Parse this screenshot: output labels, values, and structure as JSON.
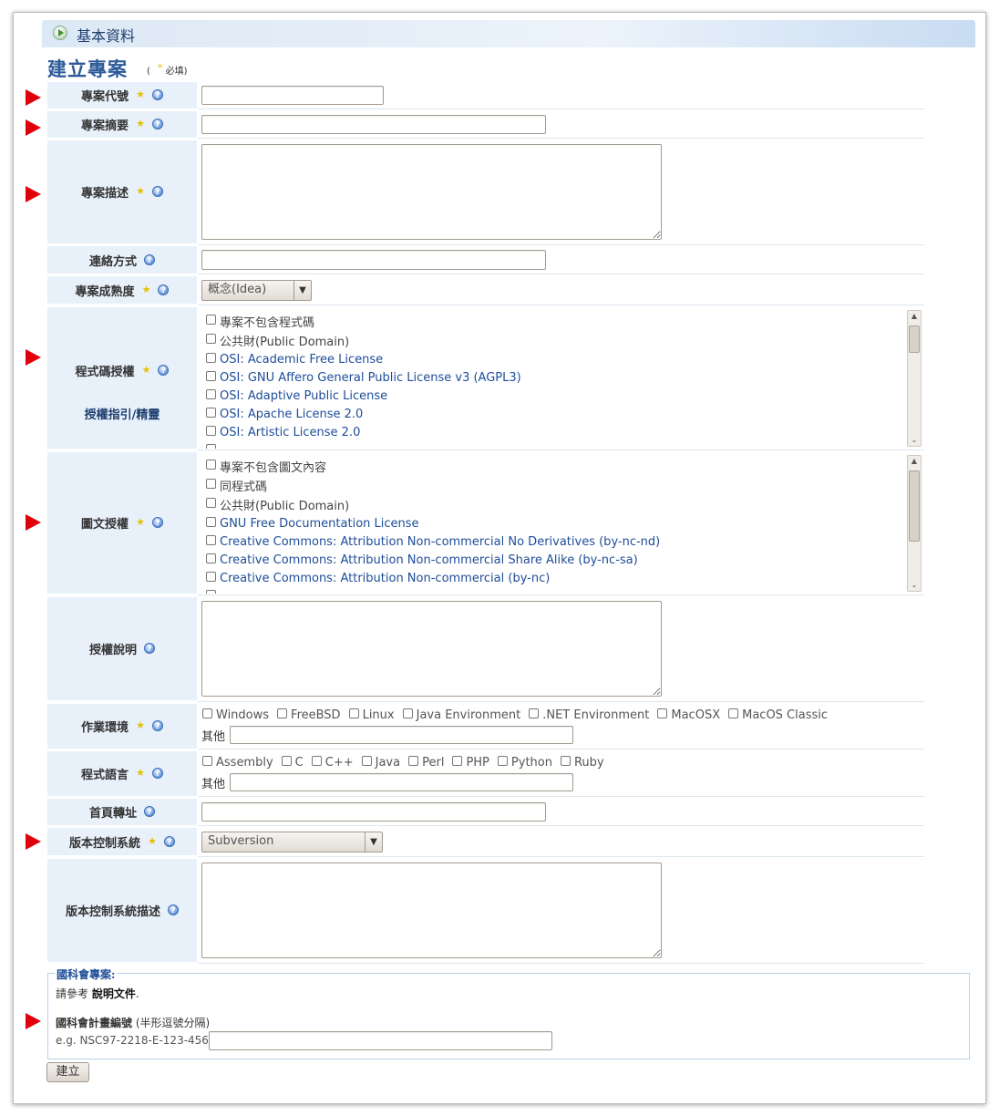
{
  "header": {
    "title": "基本資料"
  },
  "form": {
    "title": "建立專案",
    "required_note": {
      "open": "(",
      "star": "*",
      "text": "必填)"
    },
    "fields": {
      "project_code": {
        "label": "專案代號",
        "value": ""
      },
      "project_summary": {
        "label": "專案摘要",
        "value": ""
      },
      "project_description": {
        "label": "專案描述",
        "value": ""
      },
      "contact": {
        "label": "連絡方式",
        "value": ""
      },
      "maturity": {
        "label": "專案成熟度",
        "selected": "概念(Idea)"
      },
      "code_license": {
        "label": "程式碼授權",
        "guide_link": "授權指引/精靈",
        "options": [
          "專案不包含程式碼",
          "公共財(Public Domain)",
          "OSI: Academic Free License",
          "OSI: GNU Affero General Public License v3 (AGPL3)",
          "OSI: Adaptive Public License",
          "OSI: Apache License 2.0",
          "OSI: Artistic License 2.0"
        ]
      },
      "content_license": {
        "label": "圖文授權",
        "options": [
          "專案不包含圖文內容",
          "同程式碼",
          "公共財(Public Domain)",
          "GNU Free Documentation License",
          "Creative Commons: Attribution Non-commercial No Derivatives (by-nc-nd)",
          "Creative Commons: Attribution Non-commercial Share Alike (by-nc-sa)",
          "Creative Commons: Attribution Non-commercial (by-nc)"
        ]
      },
      "license_notes": {
        "label": "授權說明",
        "value": ""
      },
      "environment": {
        "label": "作業環境",
        "options": [
          "Windows",
          "FreeBSD",
          "Linux",
          "Java Environment",
          ".NET Environment",
          "MacOSX",
          "MacOS Classic"
        ],
        "other_label": "其他",
        "other_value": ""
      },
      "language": {
        "label": "程式語言",
        "options": [
          "Assembly",
          "C",
          "C++",
          "Java",
          "Perl",
          "PHP",
          "Python",
          "Ruby"
        ],
        "other_label": "其他",
        "other_value": ""
      },
      "homepage": {
        "label": "首頁轉址",
        "value": ""
      },
      "vcs": {
        "label": "版本控制系統",
        "selected": "Subversion"
      },
      "vcs_description": {
        "label": "版本控制系統描述",
        "value": ""
      }
    },
    "nsc": {
      "legend": "國科會專案:",
      "ref_prefix": "請參考",
      "ref_link": "說明文件",
      "ref_suffix": ".",
      "id_label": "國科會計畫編號",
      "id_hint": "(半形逗號分隔)",
      "example": "e.g. NSC97-2218-E-123-456",
      "id_value": ""
    },
    "submit_label": "建立"
  },
  "colors": {
    "label_bg": "#e8f0fa",
    "link": "#1e4d99",
    "title": "#2d5a9a",
    "arrow": "#e0000c",
    "star": "#e8c000"
  },
  "icons": {
    "help": "help-icon",
    "required": "required-star-icon",
    "play": "play-icon",
    "arrow": "red-arrow-icon"
  }
}
